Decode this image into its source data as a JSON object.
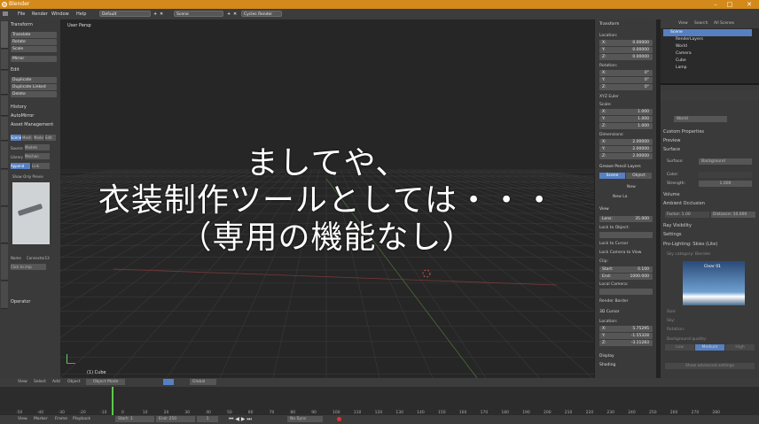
{
  "app": {
    "title": "Blender"
  },
  "menubar": {
    "items": [
      "File",
      "Render",
      "Window",
      "Help"
    ],
    "layout": "Default",
    "scene": "Scene",
    "engine": "Cycles Render"
  },
  "toolshelf": {
    "transform_head": "Transform",
    "transform_buttons": [
      "Translate",
      "Rotate",
      "Scale",
      "Mirror"
    ],
    "edit_head": "Edit",
    "edit_buttons": [
      "Duplicate",
      "Duplicate Linked",
      "Delete"
    ],
    "history_head": "History",
    "auto_mirror": "AutoMirror",
    "asset_head": "Asset Management",
    "modes": [
      "Scene",
      "Mesh",
      "Mode",
      "Edit"
    ],
    "source_label": "Source",
    "source_value": "Models",
    "lib_label": "Library",
    "lib_value": "Mechan",
    "append": "Append",
    "link": "Link",
    "show_preview": "Show Only Previe",
    "name_label": "Name",
    "name_value": "Connector13",
    "click_import": "Click to imp",
    "operator": "Operator"
  },
  "viewport": {
    "label": "User Persp",
    "object": "(1) Cube",
    "overlay_lines": [
      "ましてや、",
      "衣装制作ツールとしては・・・",
      "（専用の機能なし）"
    ]
  },
  "npanel": {
    "transform": "Transform",
    "location": "Location:",
    "loc": [
      [
        "X:",
        "0.00000"
      ],
      [
        "Y:",
        "0.00000"
      ],
      [
        "Z:",
        "0.00000"
      ]
    ],
    "rotation": "Rotation:",
    "rot": [
      [
        "X:",
        "0°"
      ],
      [
        "Y:",
        "0°"
      ],
      [
        "Z:",
        "0°"
      ]
    ],
    "rot_mode": "XYZ Euler",
    "scale": "Scale:",
    "scl": [
      [
        "X:",
        "1.000"
      ],
      [
        "Y:",
        "1.000"
      ],
      [
        "Z:",
        "1.000"
      ]
    ],
    "dimensions": "Dimensions:",
    "dim": [
      [
        "X:",
        "2.00000"
      ],
      [
        "Y:",
        "2.00000"
      ],
      [
        "Z:",
        "2.00000"
      ]
    ],
    "grease": "Grease Pencil Layers",
    "scene_btn": "Scene",
    "object_btn": "Object",
    "new": "New",
    "new_layer": "New La",
    "view": "View",
    "lens_label": "Lens:",
    "lens": "35.000",
    "lock_obj": "Lock to Object:",
    "lock_cursor": "Lock to Cursor",
    "lock_cam": "Lock Camera to View",
    "clip": "Clip:",
    "start_label": "Start:",
    "start": "0.100",
    "end_label": "End:",
    "end": "1000.000",
    "local_cam": "Local Camera:",
    "render_border": "Render Border",
    "cursor3d": "3D Cursor",
    "cur_location": "Location:",
    "cur": [
      [
        "X:",
        "5.75295"
      ],
      [
        "Y:",
        "-1.55328"
      ],
      [
        "Z:",
        "-3.11283"
      ]
    ],
    "display": "Display",
    "shading": "Shading"
  },
  "outliner": {
    "tabs": [
      "View",
      "Search",
      "All Scenes"
    ],
    "rows": [
      "Scene",
      "RenderLayers",
      "World",
      "Camera",
      "Cube",
      "Lamp"
    ]
  },
  "props": {
    "world_name": "World",
    "sections": [
      "Custom Properties",
      "Preview",
      "Surface"
    ],
    "surface_label": "Surface:",
    "surface_value": "Background",
    "color_label": "Color:",
    "strength_label": "Strength:",
    "strength": "1.000",
    "volume": "Volume",
    "ao": "Ambient Occlusion",
    "factor": "Factor:",
    "factor_val": "1.00",
    "distance": "Distance:",
    "distance_val": "10.000",
    "ray_vis": "Ray Visibility",
    "settings": "Settings",
    "prolight": "Pro-Lighting: Skies (Lite)",
    "sky_category": "Sky category: Blender",
    "sky_name": "Clear 01",
    "size": "Size:",
    "sky": "Sky:",
    "rotation": "Rotation:",
    "bg_quality": "Background quality:",
    "quality": [
      "Low",
      "Medium",
      "High"
    ],
    "show_advanced": "Show advanced settings"
  },
  "timeline": {
    "menu": [
      "View",
      "Select",
      "Add",
      "Object"
    ],
    "mode": "Object Mode",
    "global": "Global",
    "ticks": [
      "-50",
      "-40",
      "-30",
      "-20",
      "-10",
      "0",
      "10",
      "20",
      "30",
      "40",
      "50",
      "60",
      "70",
      "80",
      "90",
      "100",
      "110",
      "120",
      "130",
      "140",
      "150",
      "160",
      "170",
      "180",
      "190",
      "200",
      "210",
      "220",
      "230",
      "240",
      "250",
      "260",
      "270",
      "280"
    ],
    "foot": [
      "View",
      "Marker",
      "Frame",
      "Playback"
    ],
    "start_label": "Start:",
    "start": "1",
    "end_label": "End:",
    "end": "250",
    "current": "1",
    "nosync": "No Sync"
  },
  "colors": {
    "accent": "#d48a1a",
    "active": "#5680c2"
  }
}
